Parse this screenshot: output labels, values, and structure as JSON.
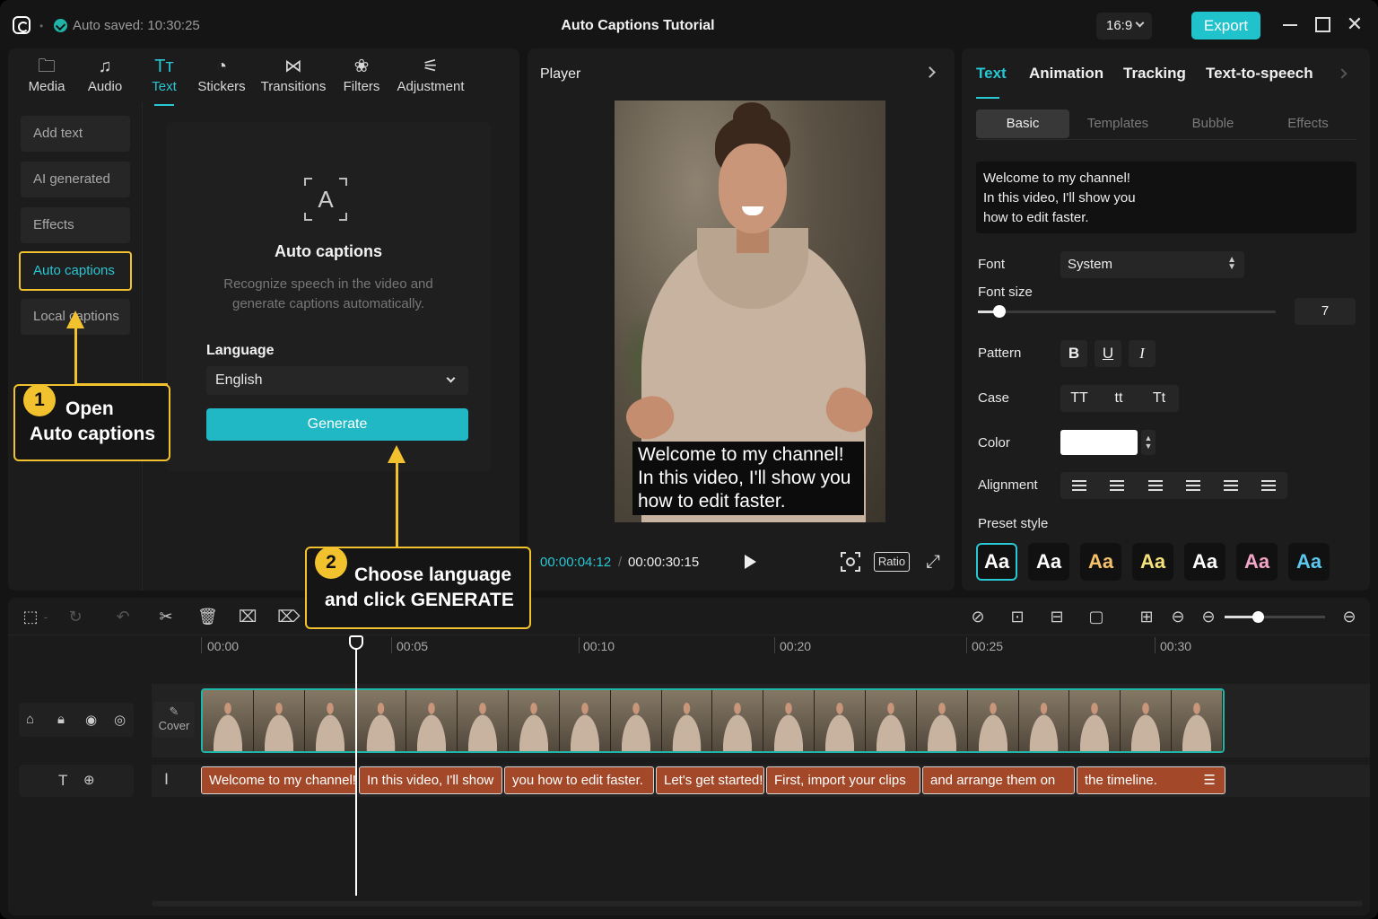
{
  "titlebar": {
    "autosave": "Auto saved: 10:30:25",
    "project_title": "Auto Captions Tutorial",
    "aspect_ratio": "16:9",
    "export_label": "Export"
  },
  "left": {
    "tools": [
      {
        "label": "Media",
        "icon": "folder-icon"
      },
      {
        "label": "Audio",
        "icon": "music-icon"
      },
      {
        "label": "Text",
        "icon": "text-icon"
      },
      {
        "label": "Stickers",
        "icon": "sticker-icon"
      },
      {
        "label": "Transitions",
        "icon": "transition-icon"
      },
      {
        "label": "Filters",
        "icon": "filter-icon"
      },
      {
        "label": "Adjustment",
        "icon": "adjust-icon"
      }
    ],
    "nav": [
      "Add text",
      "AI generated",
      "Effects",
      "Auto captions",
      "Local captions"
    ],
    "auto_captions": {
      "icon_letter": "A",
      "title": "Auto captions",
      "description": "Recognize speech in the video and generate captions automatically.",
      "language_label": "Language",
      "language_value": "English",
      "generate_label": "Generate"
    }
  },
  "player": {
    "title": "Player",
    "subtitle_lines": [
      "Welcome to my channel!",
      "In this video, I'll show you",
      "how to edit faster."
    ],
    "current_time": "00:00:04:12",
    "total_time": "00:00:30:15",
    "ratio_label": "Ratio"
  },
  "right": {
    "tabs": [
      "Text",
      "Animation",
      "Tracking",
      "Text-to-speech"
    ],
    "subtabs": [
      "Basic",
      "Templates",
      "Bubble",
      "Effects"
    ],
    "text_lines": [
      "Welcome to my channel!",
      "In this video, I'll show you",
      "how to edit faster."
    ],
    "font_label": "Font",
    "font_value": "System",
    "font_size_label": "Font size",
    "font_size_value": "7",
    "font_size_fraction": 0.05,
    "pattern_label": "Pattern",
    "pattern_buttons": [
      "B",
      "U",
      "I"
    ],
    "case_label": "Case",
    "case_buttons": [
      "TT",
      "tt",
      "Tt"
    ],
    "color_label": "Color",
    "color_value": "#ffffff",
    "alignment_label": "Alignment",
    "preset_label": "Preset style",
    "presets": [
      {
        "text": "Aa",
        "color": "#ffffff"
      },
      {
        "text": "Aa",
        "color": "#ffffff"
      },
      {
        "text": "Aa",
        "color": "#f5c16a"
      },
      {
        "text": "Aa",
        "color": "#f6e27a"
      },
      {
        "text": "Aa",
        "color": "#ffffff"
      },
      {
        "text": "Aa",
        "color": "#f3a6c8"
      },
      {
        "text": "Aa",
        "color": "#5cc8ee"
      }
    ]
  },
  "timeline": {
    "ruler": [
      "00:00",
      "00:05",
      "00:10",
      "00:20",
      "00:25",
      "00:30"
    ],
    "cover_label": "Cover",
    "captions": [
      "Welcome to my channel!",
      "In this video, I'll show",
      "you how to edit faster.",
      "Let's get started!",
      "First, import your clips",
      "and arrange them on",
      "the timeline."
    ]
  },
  "callouts": {
    "step1_number": "1",
    "step1_lines": [
      "Open",
      "Auto captions"
    ],
    "step2_number": "2",
    "step2_lines": [
      "Choose language",
      "and click GENERATE"
    ]
  }
}
